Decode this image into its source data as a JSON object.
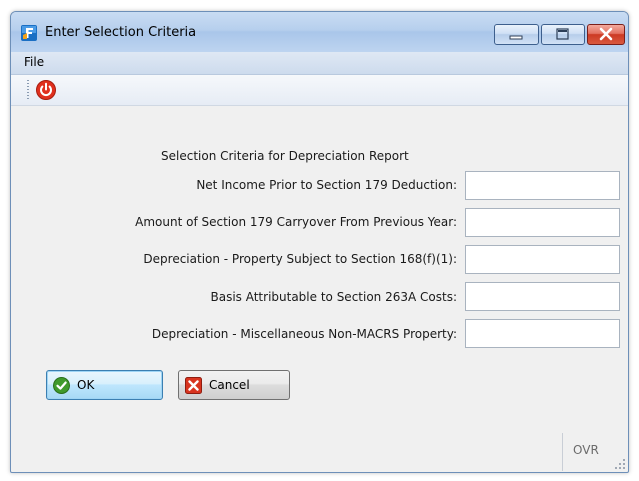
{
  "window": {
    "title": "Enter Selection Criteria"
  },
  "menu": {
    "file": "File"
  },
  "form": {
    "heading": "Selection Criteria for Depreciation Report",
    "fields": [
      {
        "label": "Net Income Prior to Section 179 Deduction:",
        "value": ""
      },
      {
        "label": "Amount of Section 179 Carryover From Previous Year:",
        "value": ""
      },
      {
        "label": "Depreciation - Property Subject to Section 168(f)(1):",
        "value": ""
      },
      {
        "label": "Basis Attributable to Section 263A Costs:",
        "value": ""
      },
      {
        "label": "Depreciation - Miscellaneous Non-MACRS Property:",
        "value": ""
      }
    ]
  },
  "buttons": {
    "ok": "OK",
    "cancel": "Cancel"
  },
  "status": {
    "mode": "OVR"
  },
  "colors": {
    "title_gradient": "#b6cfed",
    "ok_border": "#3c7fb1",
    "close_red": "#cc3a23",
    "power_red": "#e0301e"
  }
}
